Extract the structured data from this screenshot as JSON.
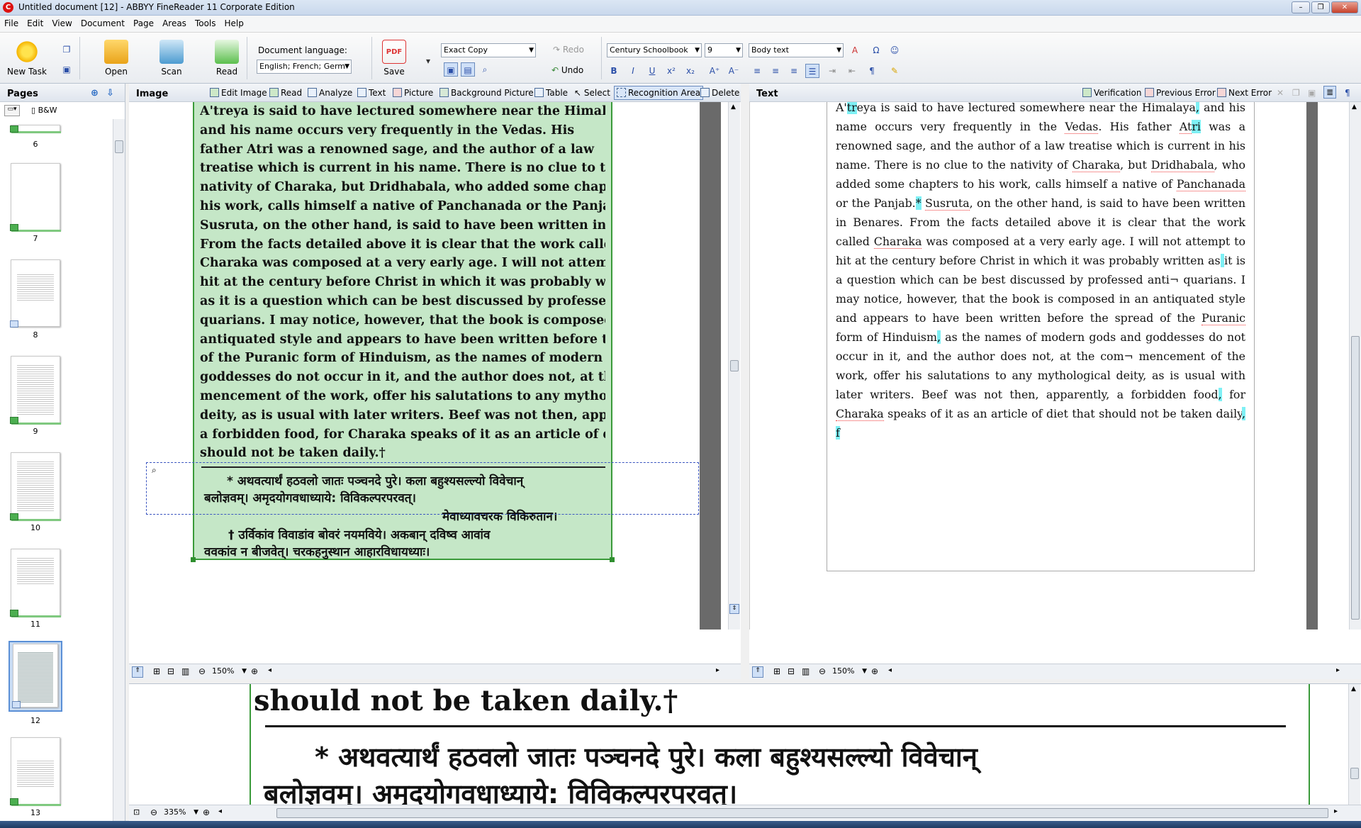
{
  "window": {
    "title": "Untitled document [12] - ABBYY FineReader 11 Corporate Edition"
  },
  "menu": [
    "File",
    "Edit",
    "View",
    "Document",
    "Page",
    "Areas",
    "Tools",
    "Help"
  ],
  "toolbar": {
    "new_task": "New Task",
    "open": "Open",
    "scan": "Scan",
    "read": "Read",
    "save": "Save",
    "doc_lang_label": "Document language:",
    "doc_lang_value": "English; French; Germ",
    "save_mode": "Exact Copy",
    "redo": "Redo",
    "undo": "Undo",
    "font": "Century Schoolbook",
    "font_size": "9",
    "style": "Body text"
  },
  "pages_panel": {
    "title": "Pages",
    "mode": "B&W",
    "thumbs": [
      "6",
      "7",
      "8",
      "9",
      "10",
      "11",
      "12",
      "13"
    ],
    "selected": "12"
  },
  "image_pane": {
    "title": "Image",
    "tools": [
      "Edit Image",
      "Read",
      "Analyze",
      "Text",
      "Picture",
      "Background Picture",
      "Table",
      "Select",
      "Recognition Area",
      "Delete"
    ],
    "zoom": "150%",
    "scan_lines": [
      "A'treya is said to have lectured somewhere near the Himalaya,",
      "and his name occurs very frequently in the Vedas. His",
      "father Atri was a renowned sage, and the author of a law",
      "treatise which is current in his name. There is no clue to the",
      "nativity of Charaka, but Dridhabala, who added some chapters to",
      "his work, calls himself a native of Panchanada or the Panjab.*",
      "Susruta, on the other hand, is said to have been written in Benares.",
      "From the facts detailed above it is clear that the work called",
      "Charaka was composed at a very early age. I will not attempt to",
      "hit at the century before Christ in which it was probably written",
      "as it is a question which can be best discussed by professed anti-",
      "quarians. I may notice, however, that the book is composed in an",
      "antiquated style and appears to have been written before the spread",
      "of the Puranic form of Hinduism, as the names of modern gods and",
      "goddesses do not occur in it, and the author does not, at the com-",
      "mencement of the work, offer his salutations to any mythological",
      "deity, as is usual with later writers. Beef was not then, apparently,",
      "a forbidden food, for Charaka speaks of it as an article of diet that",
      "should not be taken daily.†"
    ],
    "footnote_lines": [
      "* अथवत्यार्थं हठवलो जातः पञ्चनदे पुरे। कला बहुश्यसल्ल्यो विवेचान्",
      "बलोज्ञवम्। अमृदयोगवधाध्याये: विविकल्परपरवत्।",
      "मेवाध्यावचरक विकिरुतान।",
      "† उर्विकांव विवाडांव बोवरं नयमविये। अकबान् दविष्व आवांव",
      "ववकांव न बीजवेत्। चरकहनुस्थान आहारविधायध्याः।"
    ]
  },
  "text_pane": {
    "title": "Text",
    "verification": "Verification",
    "prev_error": "Previous Error",
    "next_error": "Next Error",
    "zoom": "150%"
  },
  "zoom_view": {
    "zoom": "335%",
    "line1": "should not be taken daily.†",
    "line2": "* अथवत्यार्थं हठवलो जातः पञ्चनदे पुरे। कला बहुश्यसल्ल्यो विवेचान्",
    "line3": "बलोज्ञवम्। अमृदयोगवधाध्याये: विविकल्परपरवत्।"
  }
}
